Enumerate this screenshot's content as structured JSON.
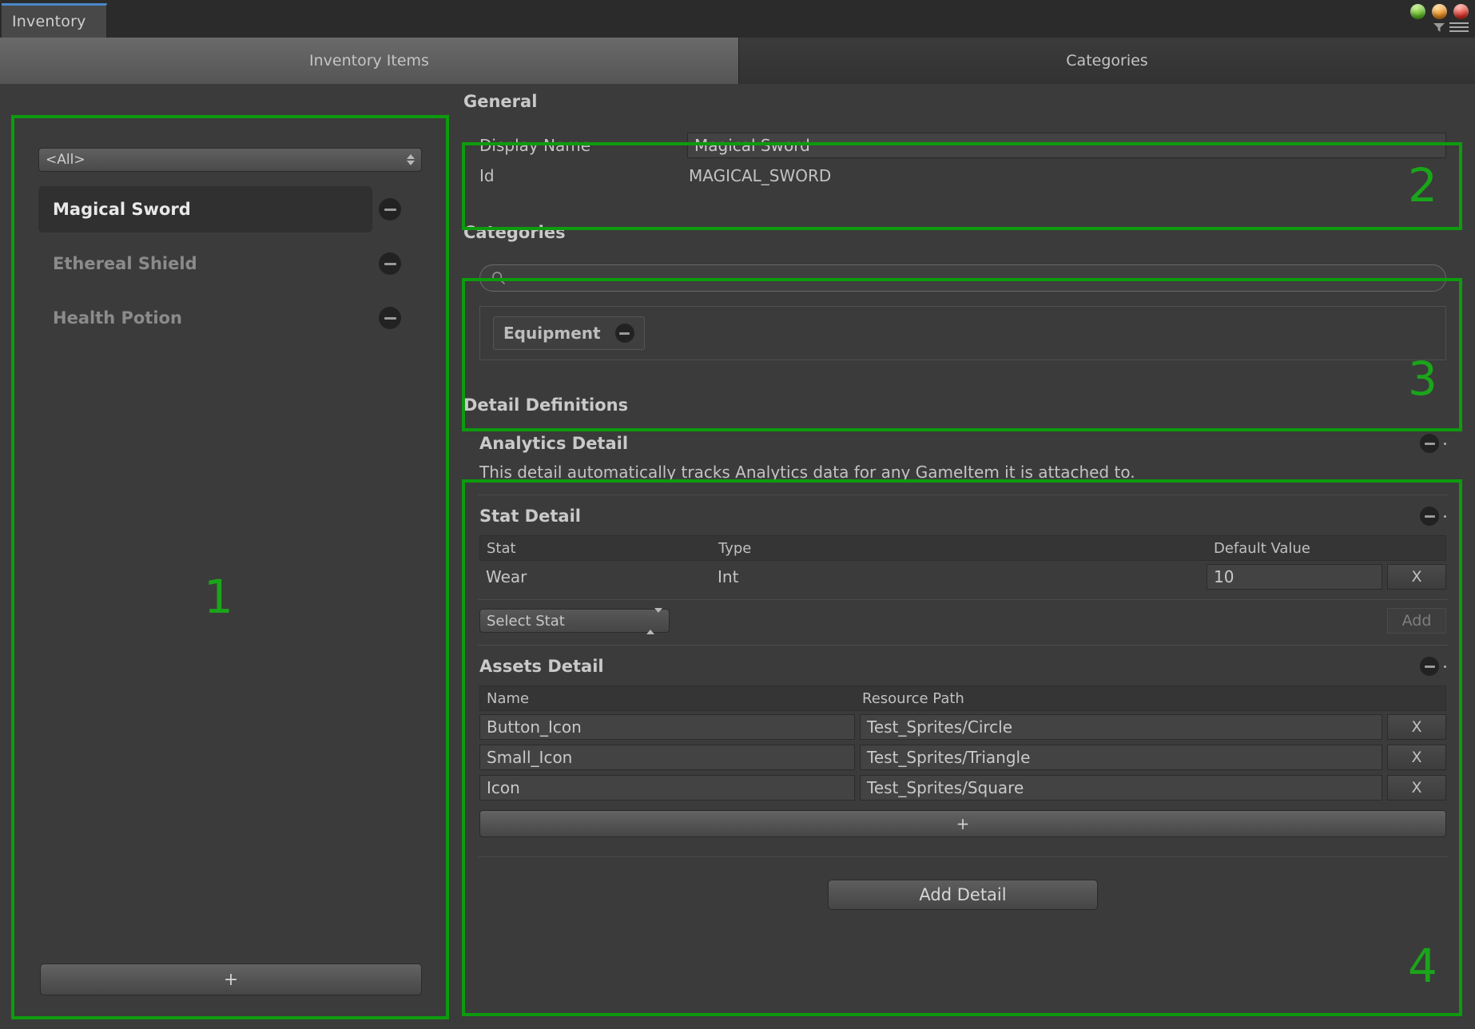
{
  "window": {
    "tab_label": "Inventory",
    "controls": [
      {
        "name": "minimize",
        "color": "#4fae1d"
      },
      {
        "name": "maximize",
        "color": "#e07a12"
      },
      {
        "name": "close",
        "color": "#d2231b"
      }
    ],
    "filter_icon": "filter-icon",
    "menu_icon": "hamburger-menu-icon"
  },
  "tabs": [
    {
      "label": "Inventory Items",
      "active": true
    },
    {
      "label": "Categories",
      "active": false
    }
  ],
  "left_panel": {
    "filter_dropdown": {
      "value": "<All>"
    },
    "items": [
      {
        "label": "Magical Sword",
        "selected": true
      },
      {
        "label": "Ethereal Shield",
        "selected": false
      },
      {
        "label": "Health Potion",
        "selected": false
      }
    ],
    "add_button_label": "+"
  },
  "general": {
    "title": "General",
    "display_name_label": "Display Name",
    "display_name_value": "Magical Sword",
    "id_label": "Id",
    "id_value": "MAGICAL_SWORD"
  },
  "categories": {
    "title": "Categories",
    "search_placeholder": "",
    "search_value": "",
    "chips": [
      {
        "label": "Equipment"
      }
    ]
  },
  "detail_definitions": {
    "title": "Detail Definitions",
    "analytics": {
      "title": "Analytics Detail",
      "description": "This detail automatically tracks Analytics data for any GameItem it is attached to."
    },
    "stat": {
      "title": "Stat Detail",
      "columns": [
        "Stat",
        "Type",
        "Default Value"
      ],
      "rows": [
        {
          "stat": "Wear",
          "type": "Int",
          "default_value": "10",
          "remove_label": "X"
        }
      ],
      "select_stat_label": "Select Stat",
      "add_label": "Add"
    },
    "assets": {
      "title": "Assets Detail",
      "columns": [
        "Name",
        "Resource Path"
      ],
      "rows": [
        {
          "name": "Button_Icon",
          "path": "Test_Sprites/Circle",
          "remove_label": "X"
        },
        {
          "name": "Small_Icon",
          "path": "Test_Sprites/Triangle",
          "remove_label": "X"
        },
        {
          "name": "Icon",
          "path": "Test_Sprites/Square",
          "remove_label": "X"
        }
      ],
      "add_row_label": "+"
    },
    "add_detail_label": "Add Detail"
  },
  "annotations": {
    "color": "#0d9b0d",
    "numbers": [
      "1",
      "2",
      "3",
      "4"
    ]
  }
}
